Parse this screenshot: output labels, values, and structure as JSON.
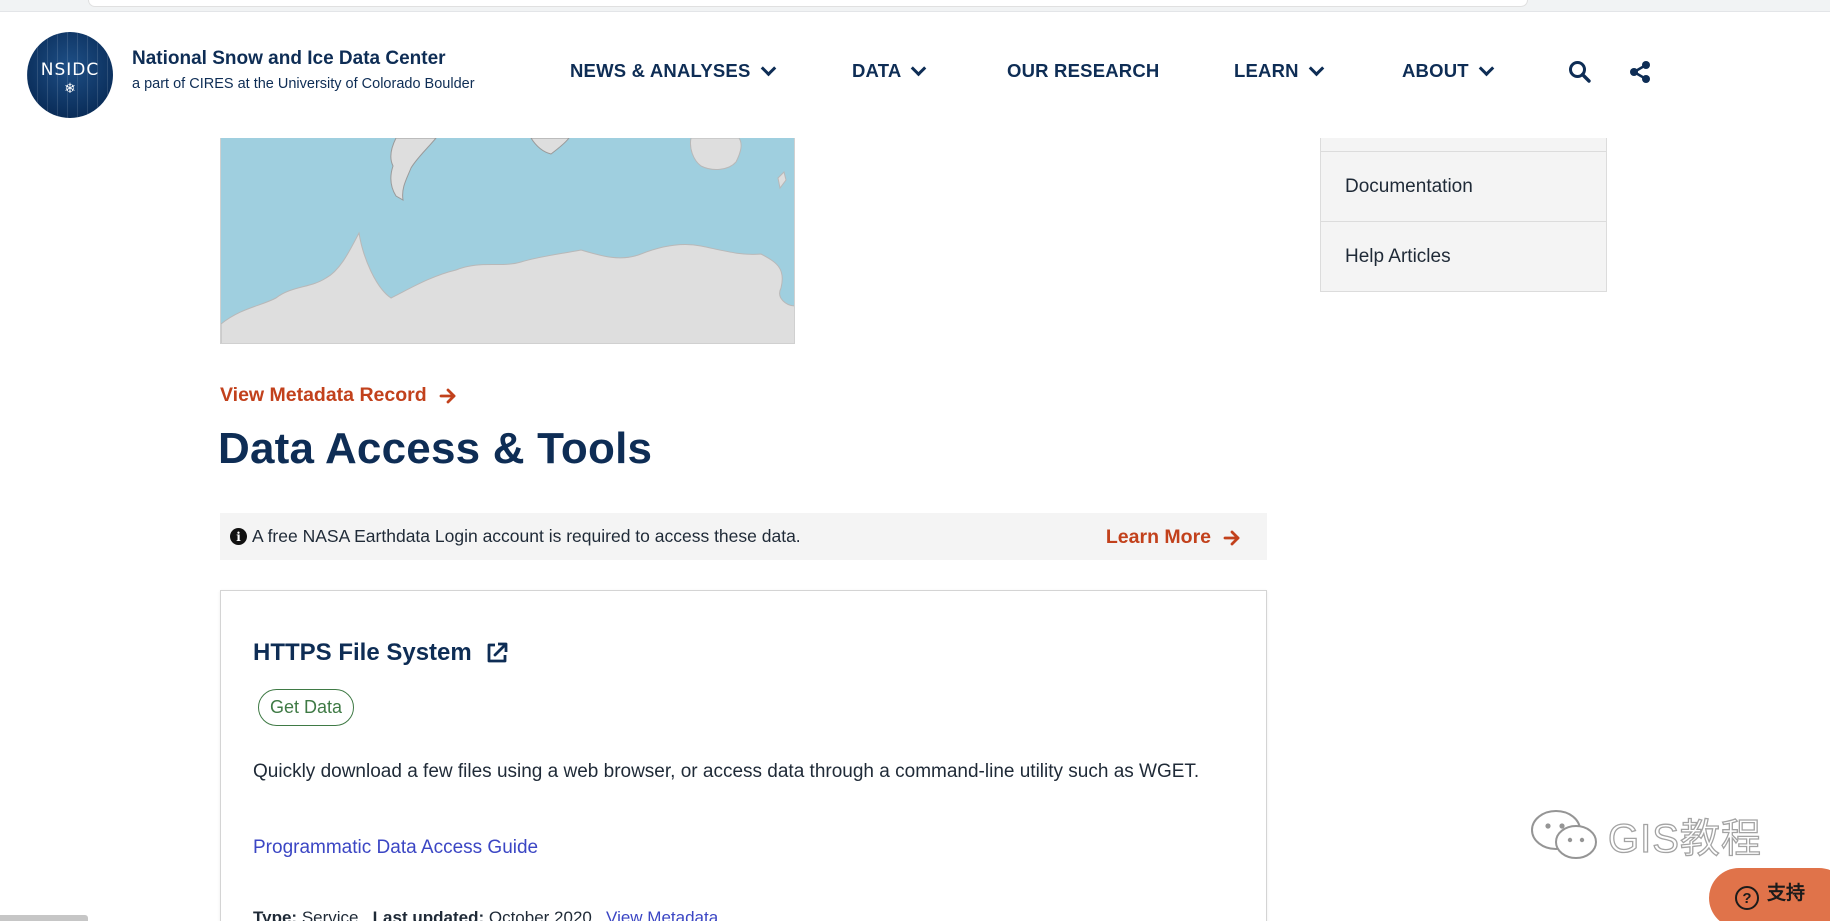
{
  "header": {
    "logo_text": "NSIDC",
    "org_name": "National Snow and Ice Data Center",
    "org_sub": "a part of CIRES at the University of Colorado Boulder",
    "nav": [
      {
        "label": "NEWS & ANALYSES",
        "dropdown": true
      },
      {
        "label": "DATA",
        "dropdown": true
      },
      {
        "label": "OUR RESEARCH",
        "dropdown": false
      },
      {
        "label": "LEARN",
        "dropdown": true
      },
      {
        "label": "ABOUT",
        "dropdown": true
      }
    ],
    "icons": [
      "search-icon",
      "share-icon"
    ]
  },
  "sidebar": {
    "items": [
      "Documentation",
      "Help Articles"
    ]
  },
  "main": {
    "metadata_link": "View Metadata Record",
    "heading": "Data Access & Tools",
    "notice": {
      "text": "A free NASA Earthdata Login account is required to access these data.",
      "link": "Learn More"
    },
    "card": {
      "title": "HTTPS File System",
      "badge": "Get Data",
      "description": "Quickly download a few files using a web browser, or access data through a command-line utility such as WGET.",
      "guide_link": "Programmatic Data Access Guide",
      "type_label": "Type:",
      "type_value": "Service",
      "updated_label": "Last updated:",
      "updated_value": "October 2020",
      "view_metadata": "View Metadata"
    }
  },
  "overlay": {
    "watermark": "GIS教程",
    "support_label": "支持"
  },
  "colors": {
    "navy": "#0e2d55",
    "accent_orange": "#c2411c",
    "link_blue": "#3b46c4",
    "badge_green": "#3f7a45",
    "ocean": "#9fcfdf",
    "land": "#dedede",
    "support_bg": "#e0734a"
  }
}
